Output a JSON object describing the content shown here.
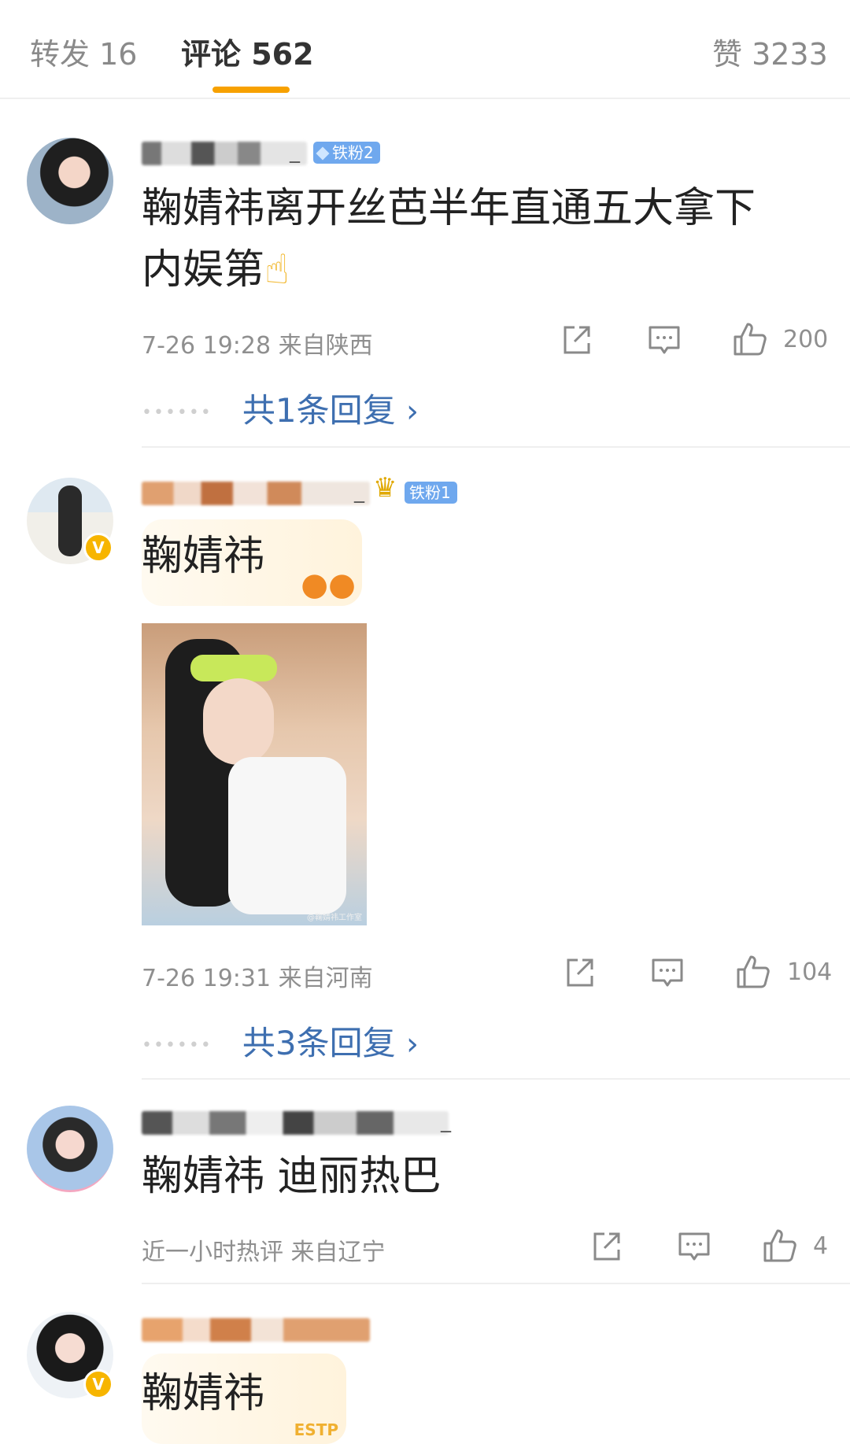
{
  "tabs": {
    "repost": "转发 16",
    "comments": "评论 562",
    "likes": "赞 3233"
  },
  "comments": [
    {
      "username_suffix": "_",
      "fan_badge": "铁粉2",
      "text_line1": "鞠婧祎离开丝芭半年直通五大拿下",
      "text_line2": "内娱第",
      "emoji": "☝",
      "time": "7-26 19:28",
      "location": "来自陕西",
      "like_count": "200",
      "replies": "共1条回复",
      "reply_arrow": "›"
    },
    {
      "username_suffix": "_",
      "fan_badge": "铁粉1",
      "verified": "V",
      "text": "鞠婧祎",
      "photo_watermark": "@鞠婧祎工作室",
      "time": "7-26 19:31",
      "location": "来自河南",
      "like_count": "104",
      "replies": "共3条回复",
      "reply_arrow": "›"
    },
    {
      "username_suffix": "_",
      "text": "鞠婧祎  迪丽热巴",
      "time": "近一小时热评",
      "location": "来自辽宁",
      "like_count": "4"
    },
    {
      "verified": "V",
      "text": "鞠婧祎",
      "bubble_deco": "ESTP"
    }
  ],
  "colors": {
    "accent": "#f7a100",
    "reply_link": "#3e6fb0",
    "fan_badge": "#6fa8ee",
    "verified": "#f7b500"
  }
}
